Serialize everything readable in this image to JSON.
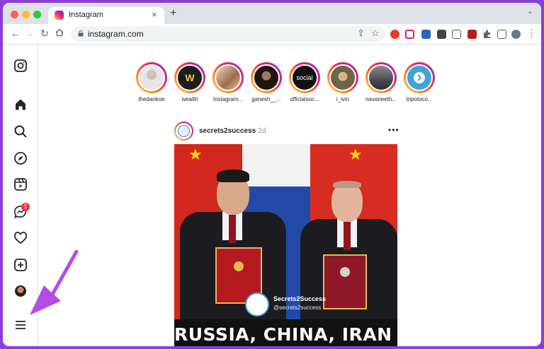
{
  "browser": {
    "tab_title": "Instagram",
    "tab_close": "×",
    "new_tab": "+",
    "tab_search": "⌄",
    "url": "instagram.com",
    "menu": "⋮"
  },
  "stories": [
    {
      "name": "thedankoe",
      "avatar_color": "#d8d8d8"
    },
    {
      "name": "wealth",
      "avatar_color": "#1d1d1d",
      "avatar_text": "W"
    },
    {
      "name": "Instagram...",
      "avatar_color": "#9b6b4f"
    },
    {
      "name": "ganesh__...",
      "avatar_color": "#3a2a22"
    },
    {
      "name": "officialsoc...",
      "avatar_color": "#1b1b1b",
      "avatar_text": "social"
    },
    {
      "name": "i_ivin",
      "avatar_color": "#7a6a4a"
    },
    {
      "name": "navaneeth...",
      "avatar_color": "#5a5a62"
    },
    {
      "name": "tripotoco...",
      "avatar_color": "#3fa4d8"
    }
  ],
  "post": {
    "username": "secrets2success",
    "time": "• 2d",
    "more": "•••",
    "watermark_name": "Secrets2Success",
    "watermark_handle": "@secrets2success",
    "headline": "RUSSIA, CHINA, IRAN AND"
  },
  "sidebar": {
    "messages_badge": "1"
  },
  "colors": {
    "background": "#8a3fd6",
    "arrow": "#b54ce8",
    "story_gradient": [
      "#feda75",
      "#d62976",
      "#962fbf"
    ],
    "badge": "#ff3040"
  }
}
